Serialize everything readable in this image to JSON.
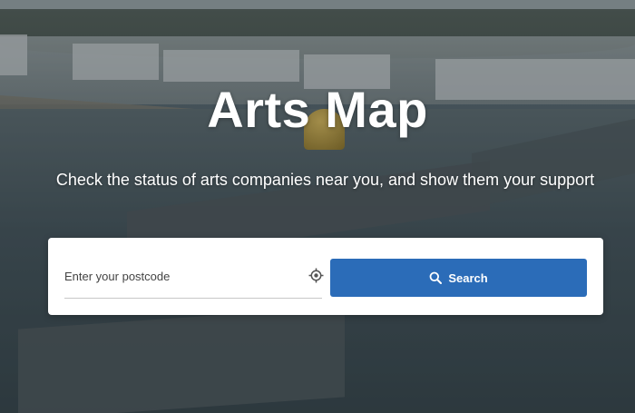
{
  "hero": {
    "title": "Arts Map",
    "subtitle": "Check the status of arts companies near you, and show them your support"
  },
  "search": {
    "postcode_placeholder": "Enter your postcode",
    "postcode_value": "",
    "locate_icon": "crosshair-icon",
    "button_icon": "search-icon",
    "button_label": "Search"
  },
  "colors": {
    "button_bg": "#2b6cb8",
    "card_bg": "#ffffff",
    "text_on_hero": "#ffffff"
  }
}
